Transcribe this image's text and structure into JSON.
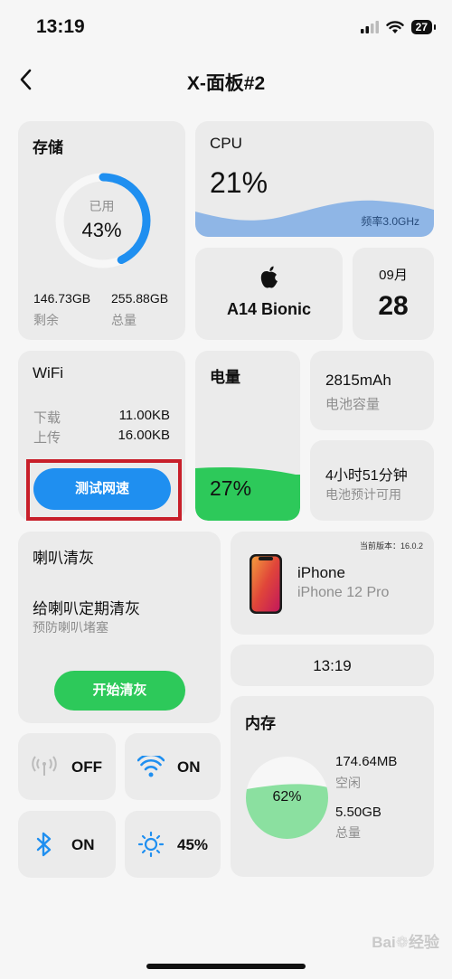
{
  "status_bar": {
    "time": "13:19",
    "battery": "27"
  },
  "header": {
    "title": "X-面板#2"
  },
  "storage": {
    "title": "存储",
    "ring_label": "已用",
    "percent": "43%",
    "used_fraction": 0.43,
    "remaining_value": "146.73GB",
    "remaining_label": "剩余",
    "total_value": "255.88GB",
    "total_label": "总量"
  },
  "cpu": {
    "title": "CPU",
    "percent": "21%",
    "freq": "频率3.0GHz"
  },
  "chip": {
    "name": "A14 Bionic"
  },
  "date": {
    "month": "09月",
    "day": "28"
  },
  "wifi": {
    "title": "WiFi",
    "download_label": "下载",
    "download_value": "11.00KB",
    "upload_label": "上传",
    "upload_value": "16.00KB",
    "button": "测试网速"
  },
  "battery_card": {
    "title": "电量",
    "percent": "27%",
    "level": 0.27
  },
  "battery_capacity": {
    "value": "2815mAh",
    "label": "电池容量"
  },
  "battery_time": {
    "value": "4小时51分钟",
    "label": "电池预计可用"
  },
  "speaker": {
    "title": "喇叭清灰",
    "subtitle": "给喇叭定期清灰",
    "hint": "预防喇叭堵塞",
    "button": "开始清灰"
  },
  "device": {
    "version": "当前版本：16.0.2",
    "name": "iPhone",
    "model": "iPhone 12 Pro"
  },
  "clock": {
    "time": "13:19"
  },
  "memory": {
    "title": "内存",
    "percent": "62%",
    "level": 0.62,
    "free_value": "174.64MB",
    "free_label": "空闲",
    "total_value": "5.50GB",
    "total_label": "总量"
  },
  "toggles": {
    "cellular": "OFF",
    "wifi": "ON",
    "bluetooth": "ON",
    "brightness": "45%"
  },
  "colors": {
    "accent_blue": "#1f8ff0",
    "green": "#2dc95a",
    "light_green": "#8be0a0",
    "highlight_red": "#c81f2a",
    "cpu_wave": "#8fb6e6"
  },
  "watermark": "Bai 经验"
}
